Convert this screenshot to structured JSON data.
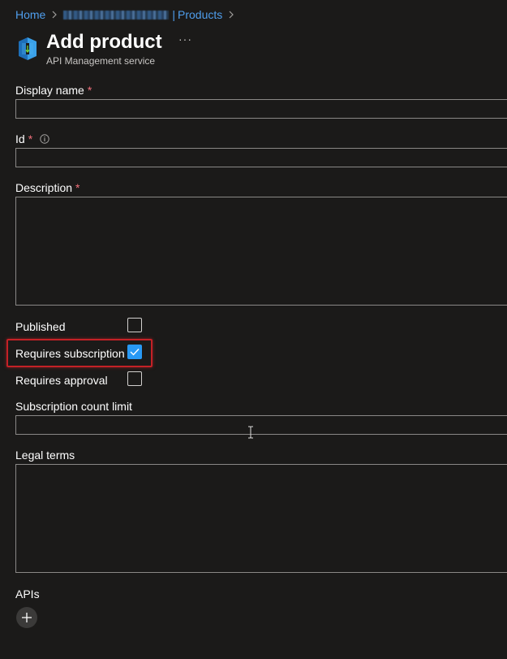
{
  "breadcrumb": {
    "home": "Home",
    "separator": "|",
    "products": "Products"
  },
  "header": {
    "title": "Add product",
    "subtitle": "API Management service",
    "more_label": "···",
    "icon": "api-management-icon"
  },
  "form": {
    "display_name": {
      "label": "Display name",
      "required_mark": "*",
      "value": ""
    },
    "id": {
      "label": "Id",
      "required_mark": "*",
      "value": "",
      "info_icon": "info-icon"
    },
    "description": {
      "label": "Description",
      "required_mark": "*",
      "value": ""
    },
    "published": {
      "label": "Published",
      "checked": false
    },
    "requires_subscription": {
      "label": "Requires subscription",
      "checked": true
    },
    "requires_approval": {
      "label": "Requires approval",
      "checked": false
    },
    "subscription_count_limit": {
      "label": "Subscription count limit",
      "value": ""
    },
    "legal_terms": {
      "label": "Legal terms",
      "value": ""
    },
    "apis": {
      "label": "APIs",
      "add_icon": "plus-icon"
    }
  },
  "colors": {
    "background": "#1b1a19",
    "link": "#4f9eed",
    "required": "#f1707b",
    "checkbox_checked": "#2899f5",
    "highlight": "#c42126",
    "border": "#8a8886"
  }
}
